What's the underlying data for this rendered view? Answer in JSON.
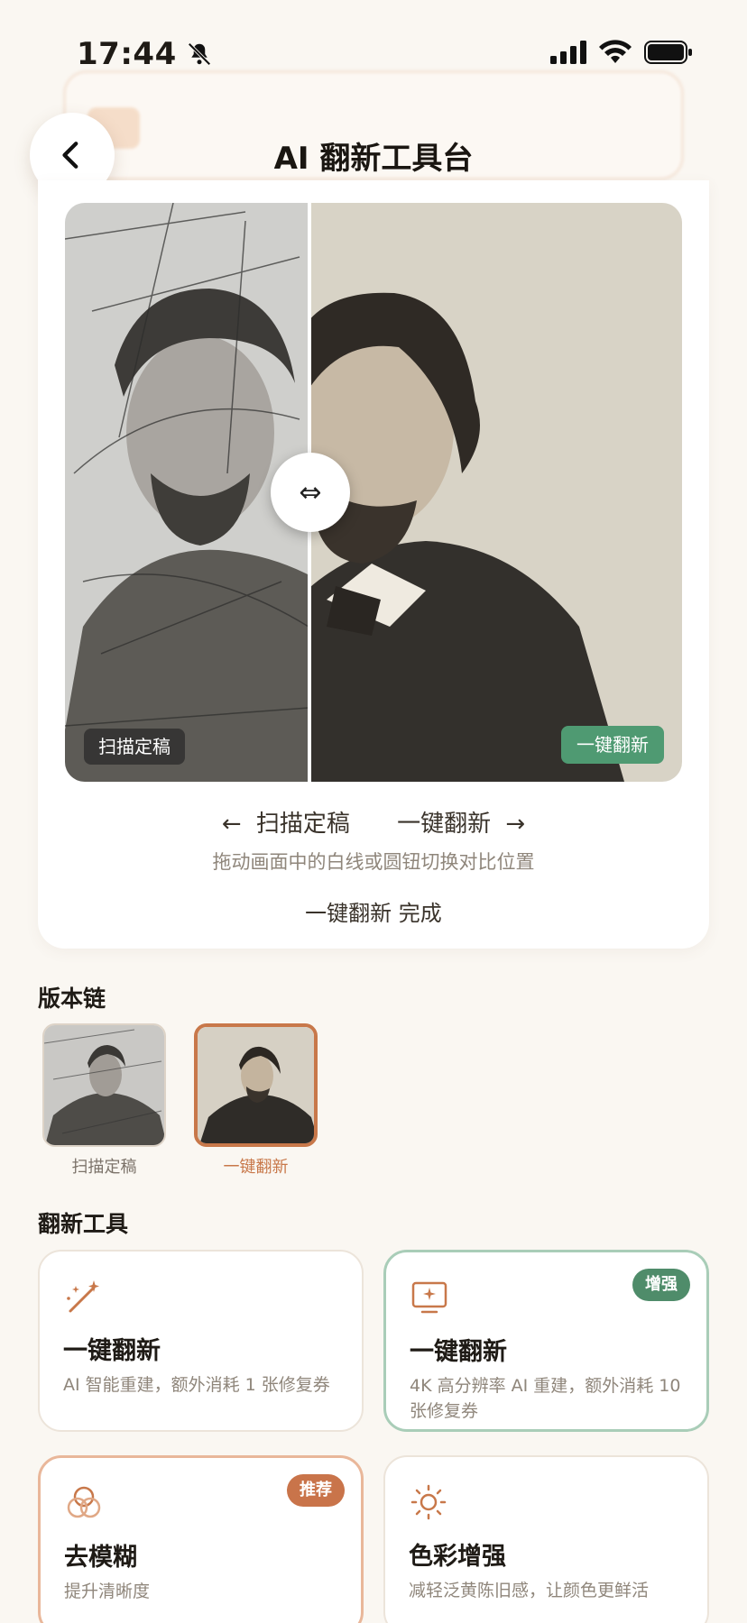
{
  "status_bar": {
    "time": "17:44"
  },
  "header": {
    "title": "AI 翻新工具台"
  },
  "compare": {
    "before_tag": "扫描定稿",
    "after_tag": "一键翻新",
    "labels_before": "← 扫描定稿",
    "labels_after": "一键翻新 →",
    "hint": "拖动画面中的白线或圆钮切换对比位置",
    "status": "一键翻新 完成",
    "divider_glyph": "⇔"
  },
  "version_chain": {
    "title": "版本链",
    "items": [
      {
        "label": "扫描定稿",
        "selected": false
      },
      {
        "label": "一键翻新",
        "selected": true
      }
    ]
  },
  "tools": {
    "title": "翻新工具",
    "items": [
      {
        "icon": "magic-wand-icon",
        "title": "一键翻新",
        "desc": "AI 智能重建，额外消耗 1 张修复券",
        "badge": ""
      },
      {
        "icon": "monitor-sparkle-icon",
        "title": "一键翻新",
        "desc": "4K 高分辨率 AI 重建，额外消耗 10 张修复券",
        "badge": "增强"
      },
      {
        "icon": "circles-icon",
        "title": "去模糊",
        "desc": "提升清晰度",
        "badge": "推荐"
      },
      {
        "icon": "sun-icon",
        "title": "色彩增强",
        "desc": "减轻泛黄陈旧感，让颜色更鲜活",
        "badge": ""
      }
    ]
  },
  "colors": {
    "accent_orange": "#c8784a",
    "accent_green": "#4f9a72",
    "background": "#faf7f2"
  }
}
